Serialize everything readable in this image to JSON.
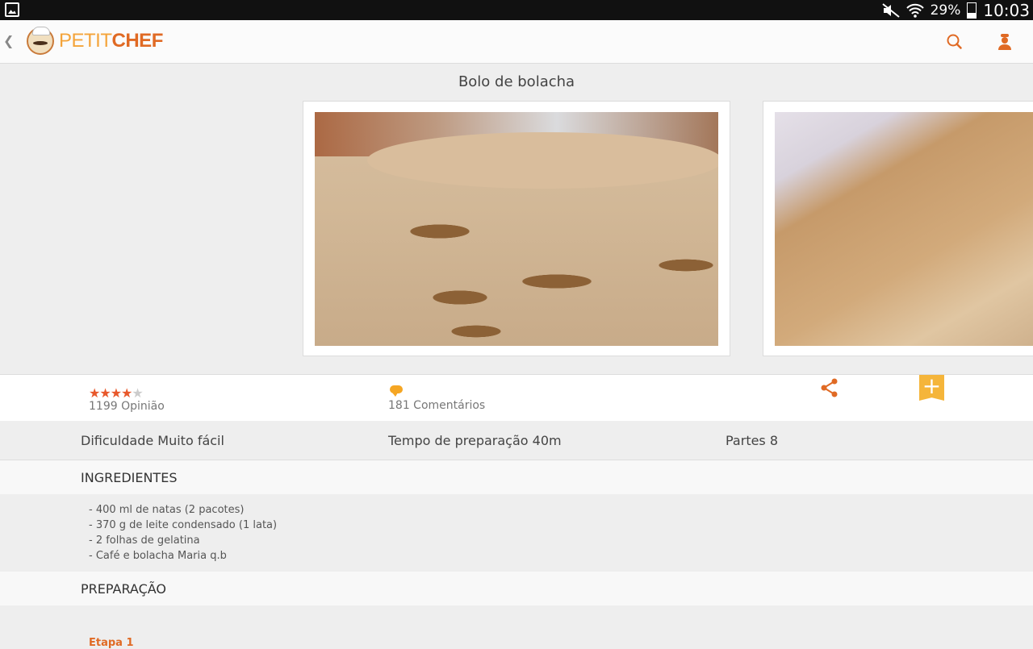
{
  "status_bar": {
    "battery": "29%",
    "battery_level": 0.29,
    "time": "10:03",
    "icons": [
      "gallery-notification-icon",
      "mute-icon",
      "wifi-icon",
      "battery-icon"
    ]
  },
  "app_bar": {
    "logo_petit": "PETIT",
    "logo_chef": "CHEF",
    "icons": [
      "back-icon",
      "chef-logo-icon",
      "search-icon",
      "user-icon"
    ],
    "accent_color": "#e06a24"
  },
  "recipe": {
    "title": "Bolo de bolacha",
    "rating_stars": 4,
    "rating_max": 5,
    "reviews": "1199 Opinião",
    "comments": "181 Comentários",
    "add_label": "+",
    "difficulty": "Dificuldade Muito fácil",
    "prep_time": "Tempo de preparação 40m",
    "servings": "Partes 8"
  },
  "ingredients": {
    "heading": "INGREDIENTES",
    "items": [
      "- 400 ml de natas (2 pacotes)",
      "- 370 g de leite condensado (1 lata)",
      "- 2 folhas de gelatina",
      "- Café e bolacha Maria q.b"
    ]
  },
  "preparation": {
    "heading": "PREPARAÇÃO",
    "first_step": "Etapa 1"
  }
}
